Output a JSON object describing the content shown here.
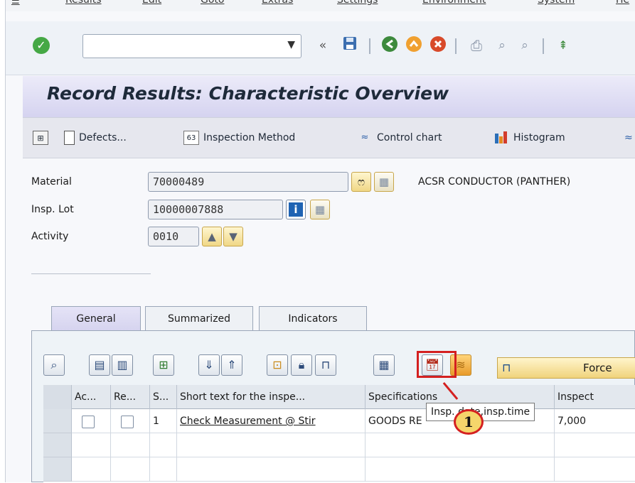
{
  "menubar": {
    "items": [
      "Results",
      "Edit",
      "Goto",
      "Extras",
      "Settings",
      "Environment",
      "System",
      "He"
    ]
  },
  "system_toolbar": {
    "command_field_value": "",
    "icons": [
      "enter-check-icon",
      "dropdown-arrow-icon",
      "collapse-chevrons-icon",
      "save-icon",
      "back-icon",
      "exit-icon",
      "cancel-icon",
      "print-icon",
      "find-icon",
      "find-next-icon"
    ]
  },
  "title": "Record Results: Characteristic Overview",
  "app_toolbar": {
    "buttons": [
      {
        "label": ""
      },
      {
        "label": "Defects..."
      },
      {
        "label": "Inspection Method"
      },
      {
        "label": "Control chart"
      },
      {
        "label": "Histogram"
      }
    ]
  },
  "header": {
    "material_label": "Material",
    "material_value": "70000489",
    "material_desc": "ACSR CONDUCTOR (PANTHER)",
    "lot_label": "Insp. Lot",
    "lot_value": "10000007888",
    "activity_label": "Activity",
    "activity_value": "0010"
  },
  "tabs": [
    {
      "label": "General",
      "active": true
    },
    {
      "label": "Summarized",
      "active": false
    },
    {
      "label": "Indicators",
      "active": false
    }
  ],
  "table_toolbar": {
    "force_label": "Force"
  },
  "grid": {
    "columns": [
      "Ac...",
      "Re...",
      "S...",
      "Short text for the inspe...",
      "Specifications",
      "Inspect"
    ],
    "rows": [
      {
        "s": "1",
        "short_text": "Check Measurement @ Stir",
        "spec": "GOODS RE",
        "inspect": "7,000"
      }
    ]
  },
  "tooltip": "Insp. date,insp.time",
  "callout": "1",
  "colors": {
    "highlight": "#d42020",
    "title_bg": "#d5d3f0",
    "callout_fill": "#f5d56b"
  }
}
